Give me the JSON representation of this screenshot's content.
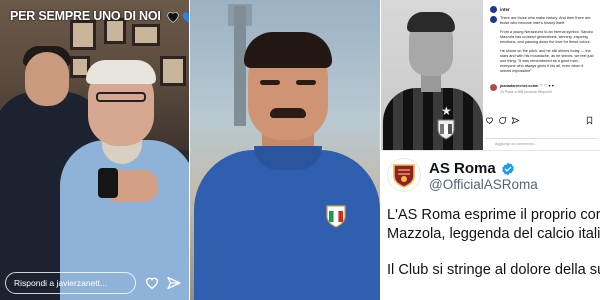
{
  "story": {
    "caption": "PER SEMPRE UNO DI NOI",
    "hearts": [
      {
        "name": "black-heart-icon",
        "color": "#111111"
      },
      {
        "name": "blue-heart-icon",
        "color": "#2f7fe6"
      },
      {
        "name": "black-heart-icon",
        "color": "#111111"
      },
      {
        "name": "blue-heart-icon",
        "color": "#2f7fe6"
      }
    ],
    "reply_placeholder": "Rispondi a javierzanett..."
  },
  "post": {
    "account": "inter",
    "caption_p1": "There are those who make history. And then there are those who become inter's history itself.",
    "caption_p2": "From a young Nerazzurro to an eternal symbol: Sandro Mazzola has crossed generations, winning, inspiring emotions, and passing down the love for these colors.",
    "caption_p3": "He shone on the pitch, and he still shines today — the stars and with his moustache, as he shines, we feel just one thing: \"It was remembered as a good man, everyone who always gives it his all, even when it seems impossible\"",
    "commenter": "juanadarrecher.ochm",
    "comment": "♡ ♡ ♥ ♥",
    "comment_meta": "2h   Piace a 366 persone   Rispondi",
    "likes": "",
    "add_comment": "Aggiungi un commento..."
  },
  "tweet": {
    "name": "AS Roma",
    "handle": "@OfficialASRoma",
    "line1": "L'AS Roma esprime il proprio cord",
    "line2": "Mazzola, leggenda del calcio itali",
    "line3": "Il Club si stringe al dolore della su"
  },
  "colors": {
    "instagram_blue": "#2f7fe6",
    "verified_blue": "#1d9bf0",
    "roma_red": "#8e1f2f",
    "roma_gold": "#f0bc42"
  }
}
